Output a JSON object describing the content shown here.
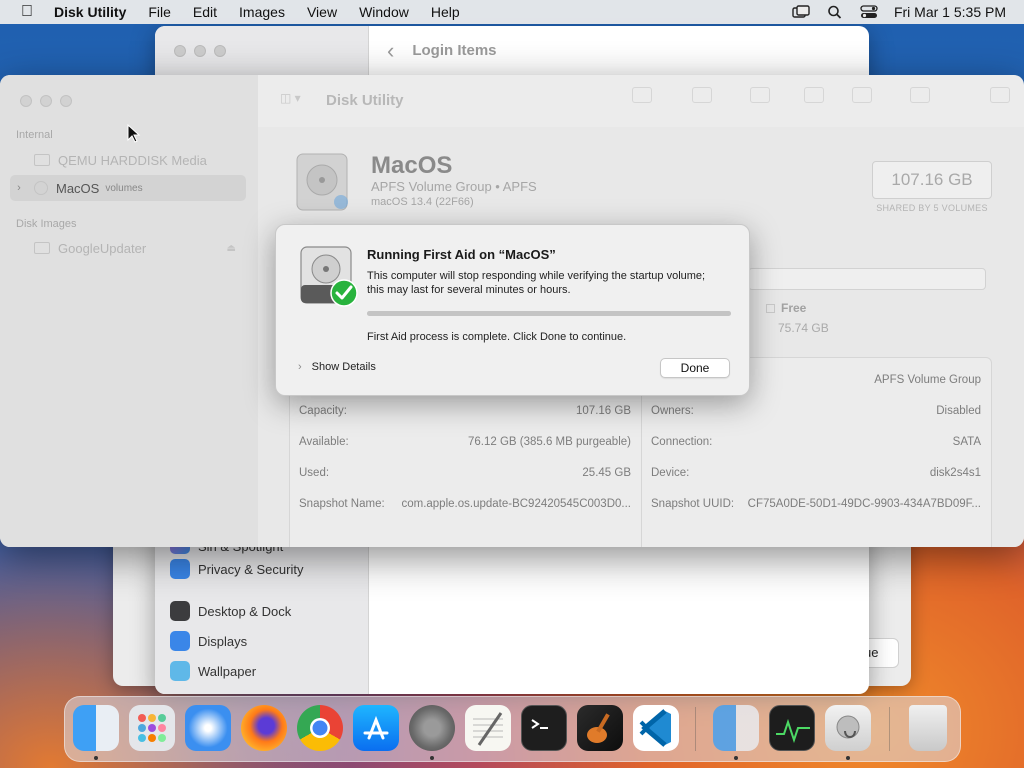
{
  "menubar": {
    "app_name": "Disk Utility",
    "menus": [
      "File",
      "Edit",
      "Images",
      "View",
      "Window",
      "Help"
    ],
    "clock": "Fri Mar 1  5:35 PM"
  },
  "settings_window": {
    "title": "Login Items",
    "sidebar_items": [
      {
        "label": "Siri & Spotlight",
        "icon": "siri-icon"
      },
      {
        "label": "Privacy & Security",
        "icon": "hand-icon"
      },
      {
        "label": "Desktop & Dock",
        "icon": "dock-icon"
      },
      {
        "label": "Displays",
        "icon": "sun-icon"
      },
      {
        "label": "Wallpaper",
        "icon": "wallpaper-icon"
      }
    ],
    "continue_label": "ue"
  },
  "disk_utility": {
    "title": "Disk Utility",
    "sidebar": {
      "internal_header": "Internal",
      "disk_images_header": "Disk Images",
      "items": [
        {
          "label": "QEMU HARDDISK Media"
        },
        {
          "label": "MacOS",
          "sublabel": "volumes"
        },
        {
          "label": "GoogleUpdater"
        }
      ]
    },
    "volume": {
      "name": "MacOS",
      "type": "APFS Volume Group • APFS",
      "os": "macOS 13.4 (22F66)",
      "size": "107.16 GB",
      "shared": "SHARED BY 5 VOLUMES",
      "free_label": "Free",
      "free_value": "75.74 GB"
    },
    "info": {
      "left": [
        {
          "label": "Capacity:",
          "value": "107.16 GB"
        },
        {
          "label": "Available:",
          "value": "76.12 GB (385.6 MB purgeable)"
        },
        {
          "label": "Used:",
          "value": "25.45 GB"
        },
        {
          "label": "Snapshot Name:",
          "value": "com.apple.os.update-BC92420545C003D0..."
        }
      ],
      "right_top": "APFS Volume Group",
      "right": [
        {
          "label": "Owners:",
          "value": "Disabled"
        },
        {
          "label": "Connection:",
          "value": "SATA"
        },
        {
          "label": "Device:",
          "value": "disk2s4s1"
        },
        {
          "label": "Snapshot UUID:",
          "value": "CF75A0DE-50D1-49DC-9903-434A7BD09F..."
        }
      ]
    }
  },
  "dialog": {
    "title": "Running First Aid on “MacOS”",
    "message": "This computer will stop responding while verifying the startup volume; this may last for several minutes or hours.",
    "progress": 1.0,
    "status": "First Aid process is complete. Click Done to continue.",
    "details_label": "Show Details",
    "done_label": "Done"
  },
  "dock": {
    "apps": [
      "finder",
      "launchpad",
      "safari",
      "firefox",
      "chrome",
      "app-store",
      "system-settings",
      "textedit",
      "terminal",
      "garageband",
      "vscode",
      "finder-2",
      "activity-monitor",
      "disk-utility",
      "trash"
    ]
  }
}
